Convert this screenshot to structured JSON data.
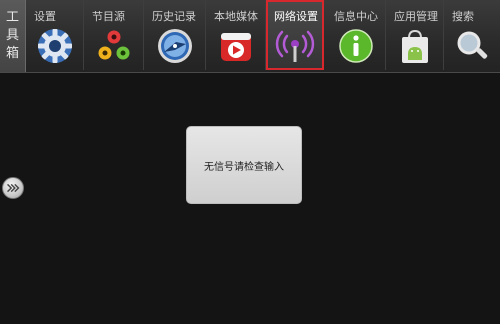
{
  "toolbox": {
    "label": "工具箱"
  },
  "menu": {
    "items": [
      {
        "label": "设置",
        "icon": "gear-icon"
      },
      {
        "label": "节目源",
        "icon": "source-dots-icon"
      },
      {
        "label": "历史记录",
        "icon": "history-clock-icon"
      },
      {
        "label": "本地媒体",
        "icon": "media-play-icon"
      },
      {
        "label": "网络设置",
        "icon": "network-antenna-icon",
        "selected": true
      },
      {
        "label": "信息中心",
        "icon": "info-icon"
      },
      {
        "label": "应用管理",
        "icon": "android-bag-icon"
      },
      {
        "label": "搜索",
        "icon": "magnifier-icon"
      }
    ]
  },
  "dialog": {
    "message": "无信号请检查输入"
  },
  "colors": {
    "background": "#141414",
    "selected_border": "#d9272e"
  }
}
